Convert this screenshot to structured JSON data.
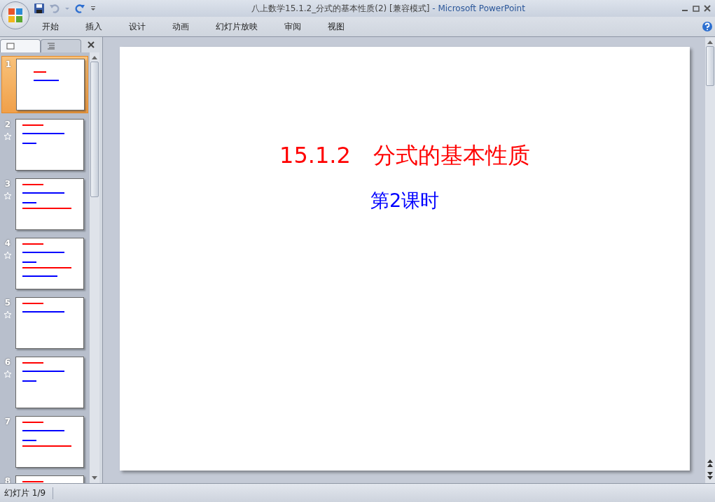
{
  "window": {
    "title_document": "八上数学15.1.2_分式的基本性质(2) [兼容模式]",
    "title_app": "- Microsoft PowerPoint"
  },
  "ribbon_tabs": [
    {
      "label": "开始",
      "selected": false
    },
    {
      "label": "插入",
      "selected": false
    },
    {
      "label": "设计",
      "selected": false
    },
    {
      "label": "动画",
      "selected": false
    },
    {
      "label": "幻灯片放映",
      "selected": false
    },
    {
      "label": "审阅",
      "selected": false
    },
    {
      "label": "视图",
      "selected": false
    }
  ],
  "panel_tabs": [
    {
      "kind": "slides",
      "selected": true
    },
    {
      "kind": "outline",
      "selected": false
    }
  ],
  "slides": [
    {
      "number": "1",
      "selected": true,
      "animated": false
    },
    {
      "number": "2",
      "selected": false,
      "animated": true
    },
    {
      "number": "3",
      "selected": false,
      "animated": true
    },
    {
      "number": "4",
      "selected": false,
      "animated": true
    },
    {
      "number": "5",
      "selected": false,
      "animated": true
    },
    {
      "number": "6",
      "selected": false,
      "animated": true
    },
    {
      "number": "7",
      "selected": false,
      "animated": false
    },
    {
      "number": "8",
      "selected": false,
      "animated": false
    }
  ],
  "current_slide": {
    "title": "15.1.2　分式的基本性质",
    "subtitle": "第2课时"
  },
  "status_bar": {
    "slide_position": "幻灯片 1/9"
  }
}
